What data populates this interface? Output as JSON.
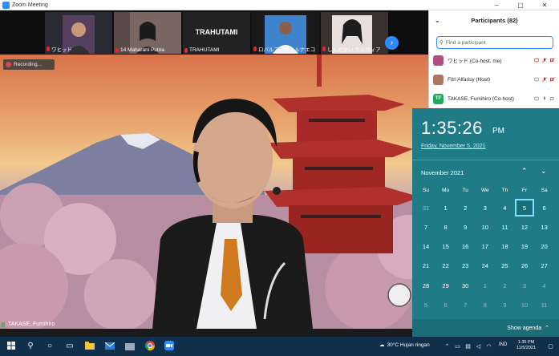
{
  "window": {
    "title": "Zoom Meeting"
  },
  "strip": {
    "thumbs": [
      {
        "name": "ワヒッド"
      },
      {
        "name": "14 Maharani Putria"
      },
      {
        "name": "TRAHUTAMI",
        "center_text": "TRAHUTAMI"
      },
      {
        "name": "ロバルアンギャルナエコ"
      },
      {
        "name": "しんせかい サルヴィア"
      }
    ]
  },
  "video": {
    "recording_label": "Recording...",
    "speaker_name": "TAKASE, Fumihiro"
  },
  "participants": {
    "title": "Participants (82)",
    "search_placeholder": "Find a participant",
    "rows": [
      {
        "name": "ワヒッド (Co-host, me)",
        "avatar_color": "#b05080"
      },
      {
        "name": "Fitri Alfarisy (Host)",
        "avatar_color": "#b07560"
      },
      {
        "name": "TAKASE, Fumihiro (Co-host)",
        "avatar_initials": "TF",
        "avatar_color": "#1fab5f"
      }
    ]
  },
  "calendar": {
    "time": "1:35:26",
    "ampm": "PM",
    "date_long": "Friday, November 5, 2021",
    "month_label": "November 2021",
    "weekdays": [
      "Su",
      "Mo",
      "Tu",
      "We",
      "Th",
      "Fr",
      "Sa"
    ],
    "weeks": [
      [
        "31",
        "1",
        "2",
        "3",
        "4",
        "5",
        "6"
      ],
      [
        "7",
        "8",
        "9",
        "10",
        "11",
        "12",
        "13"
      ],
      [
        "14",
        "15",
        "16",
        "17",
        "18",
        "19",
        "20"
      ],
      [
        "21",
        "22",
        "23",
        "24",
        "25",
        "26",
        "27"
      ],
      [
        "28",
        "29",
        "30",
        "1",
        "2",
        "3",
        "4"
      ],
      [
        "5",
        "6",
        "7",
        "8",
        "9",
        "10",
        "11"
      ]
    ],
    "today": "5",
    "show_agenda": "Show agenda"
  },
  "taskbar": {
    "weather": "30°C  Hujan ringan",
    "lang": "IND",
    "clock_time": "1:35 PM",
    "clock_date": "11/5/2021"
  },
  "colors": {
    "zoom_blue": "#2d8cff",
    "calendar_bg": "#1f7c87",
    "taskbar_bg": "#0f2f4a",
    "muted_red": "#e02828"
  }
}
